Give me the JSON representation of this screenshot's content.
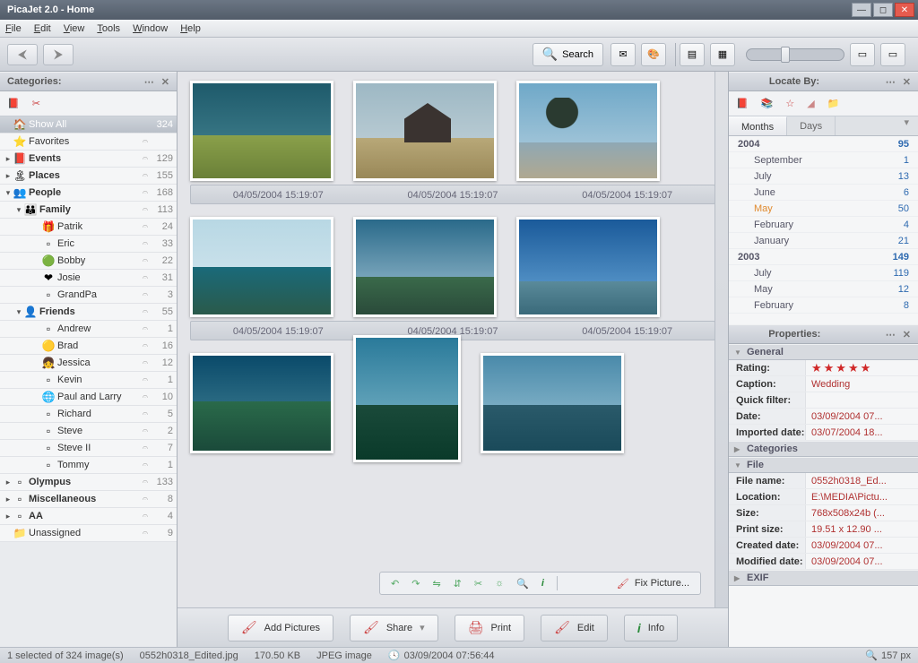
{
  "window": {
    "title": "PicaJet 2.0 - Home"
  },
  "menu": {
    "file": "File",
    "edit": "Edit",
    "view": "View",
    "tools": "Tools",
    "window": "Window",
    "help": "Help"
  },
  "toolbar": {
    "search": "Search"
  },
  "categories": {
    "title": "Categories:",
    "items": [
      {
        "exp": "",
        "icon": "🏠",
        "label": "Show All",
        "count": "324",
        "sel": true,
        "indent": 0
      },
      {
        "exp": "",
        "icon": "⭐",
        "label": "Favorites",
        "count": "",
        "indent": 0
      },
      {
        "exp": "▸",
        "icon": "📕",
        "label": "Events",
        "count": "129",
        "indent": 0,
        "bold": true
      },
      {
        "exp": "▸",
        "icon": "🏝",
        "label": "Places",
        "count": "155",
        "indent": 0,
        "bold": true
      },
      {
        "exp": "▾",
        "icon": "👥",
        "label": "People",
        "count": "168",
        "indent": 0,
        "bold": true
      },
      {
        "exp": "▾",
        "icon": "👪",
        "label": "Family",
        "count": "113",
        "indent": 1,
        "bold": true
      },
      {
        "exp": "",
        "icon": "🎁",
        "label": "Patrik",
        "count": "24",
        "indent": 2
      },
      {
        "exp": "",
        "icon": "▫",
        "label": "Eric",
        "count": "33",
        "indent": 2
      },
      {
        "exp": "",
        "icon": "🟢",
        "label": "Bobby",
        "count": "22",
        "indent": 2
      },
      {
        "exp": "",
        "icon": "❤",
        "label": "Josie",
        "count": "31",
        "indent": 2
      },
      {
        "exp": "",
        "icon": "▫",
        "label": "GrandPa",
        "count": "3",
        "indent": 2
      },
      {
        "exp": "▾",
        "icon": "👤",
        "label": "Friends",
        "count": "55",
        "indent": 1,
        "bold": true
      },
      {
        "exp": "",
        "icon": "▫",
        "label": "Andrew",
        "count": "1",
        "indent": 2
      },
      {
        "exp": "",
        "icon": "🟡",
        "label": "Brad",
        "count": "16",
        "indent": 2
      },
      {
        "exp": "",
        "icon": "👧",
        "label": "Jessica",
        "count": "12",
        "indent": 2
      },
      {
        "exp": "",
        "icon": "▫",
        "label": "Kevin",
        "count": "1",
        "indent": 2
      },
      {
        "exp": "",
        "icon": "🌐",
        "label": "Paul and Larry",
        "count": "10",
        "indent": 2
      },
      {
        "exp": "",
        "icon": "▫",
        "label": "Richard",
        "count": "5",
        "indent": 2
      },
      {
        "exp": "",
        "icon": "▫",
        "label": "Steve",
        "count": "2",
        "indent": 2
      },
      {
        "exp": "",
        "icon": "▫",
        "label": "Steve II",
        "count": "7",
        "indent": 2
      },
      {
        "exp": "",
        "icon": "▫",
        "label": "Tommy",
        "count": "1",
        "indent": 2
      },
      {
        "exp": "▸",
        "icon": "▫",
        "label": "Olympus",
        "count": "133",
        "indent": 0,
        "bold": true
      },
      {
        "exp": "▸",
        "icon": "▫",
        "label": "Miscellaneous",
        "count": "8",
        "indent": 0,
        "bold": true
      },
      {
        "exp": "▸",
        "icon": "▫",
        "label": "AA",
        "count": "4",
        "indent": 0,
        "bold": true
      },
      {
        "exp": "",
        "icon": "📁",
        "label": "Unassigned",
        "count": "9",
        "indent": 0
      }
    ]
  },
  "thumbs": {
    "date": "04/05/2004 15:19:07",
    "fix": "Fix Picture..."
  },
  "actions": {
    "add": "Add Pictures",
    "share": "Share",
    "print": "Print",
    "edit": "Edit",
    "info": "Info"
  },
  "locate": {
    "title": "Locate By:",
    "tab_months": "Months",
    "tab_days": "Days",
    "rows": [
      {
        "l": "2004",
        "v": "95",
        "year": true
      },
      {
        "l": "September",
        "v": "1"
      },
      {
        "l": "July",
        "v": "13"
      },
      {
        "l": "June",
        "v": "6"
      },
      {
        "l": "May",
        "v": "50",
        "hi": true
      },
      {
        "l": "February",
        "v": "4"
      },
      {
        "l": "January",
        "v": "21"
      },
      {
        "l": "2003",
        "v": "149",
        "year": true
      },
      {
        "l": "July",
        "v": "119"
      },
      {
        "l": "May",
        "v": "12"
      },
      {
        "l": "February",
        "v": "8"
      }
    ]
  },
  "props": {
    "title": "Properties:",
    "general": "General",
    "categories_g": "Categories",
    "file_g": "File",
    "exif": "EXIF",
    "rating_k": "Rating:",
    "caption_k": "Caption:",
    "caption_v": "Wedding",
    "qf_k": "Quick filter:",
    "date_k": "Date:",
    "date_v": "03/09/2004 07...",
    "imp_k": "Imported date:",
    "imp_v": "03/07/2004 18...",
    "fn_k": "File name:",
    "fn_v": "0552h0318_Ed...",
    "loc_k": "Location:",
    "loc_v": "E:\\MEDIA\\Pictu...",
    "size_k": "Size:",
    "size_v": "768x508x24b (...",
    "ps_k": "Print size:",
    "ps_v": "19.51 x 12.90 ...",
    "cd_k": "Created date:",
    "cd_v": "03/09/2004 07...",
    "md_k": "Modified date:",
    "md_v": "03/09/2004 07..."
  },
  "status": {
    "sel": "1 selected of 324 image(s)",
    "file": "0552h0318_Edited.jpg",
    "fsize": "170.50 KB",
    "ftype": "JPEG image",
    "fdate": "03/09/2004 07:56:44",
    "zoom": "157 px"
  }
}
